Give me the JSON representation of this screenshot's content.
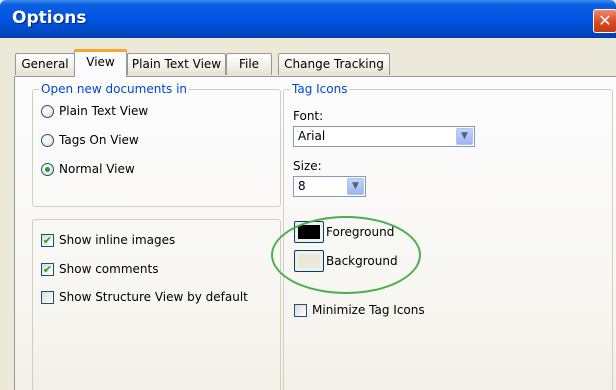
{
  "window": {
    "title": "Options",
    "close_glyph": "✕",
    "close_icon": "close-icon"
  },
  "tabs": [
    {
      "label": "General",
      "active": false
    },
    {
      "label": "View",
      "active": true
    },
    {
      "label": "Plain Text View",
      "active": false
    },
    {
      "label": "File",
      "active": false
    },
    {
      "label": "Change Tracking",
      "active": false
    }
  ],
  "open_documents": {
    "legend": "Open new documents in",
    "options": [
      {
        "label": "Plain Text View",
        "selected": false
      },
      {
        "label": "Tags On View",
        "selected": false
      },
      {
        "label": "Normal View",
        "selected": true
      }
    ]
  },
  "display_options": [
    {
      "label": "Show inline images",
      "checked": true
    },
    {
      "label": "Show comments",
      "checked": true
    },
    {
      "label": "Show Structure View by default",
      "checked": false
    }
  ],
  "tag_icons": {
    "legend": "Tag Icons",
    "font_label": "Font:",
    "font_value": "Arial",
    "size_label": "Size:",
    "size_value": "8",
    "foreground_label": "Foreground",
    "foreground_color": "#000000",
    "background_label": "Background",
    "background_color": "#ece9d8",
    "minimize_label": "Minimize Tag Icons",
    "minimize_checked": false
  },
  "check_glyph": "✔",
  "dropdown_glyph": "▼",
  "highlight_color": "#4cae4c"
}
